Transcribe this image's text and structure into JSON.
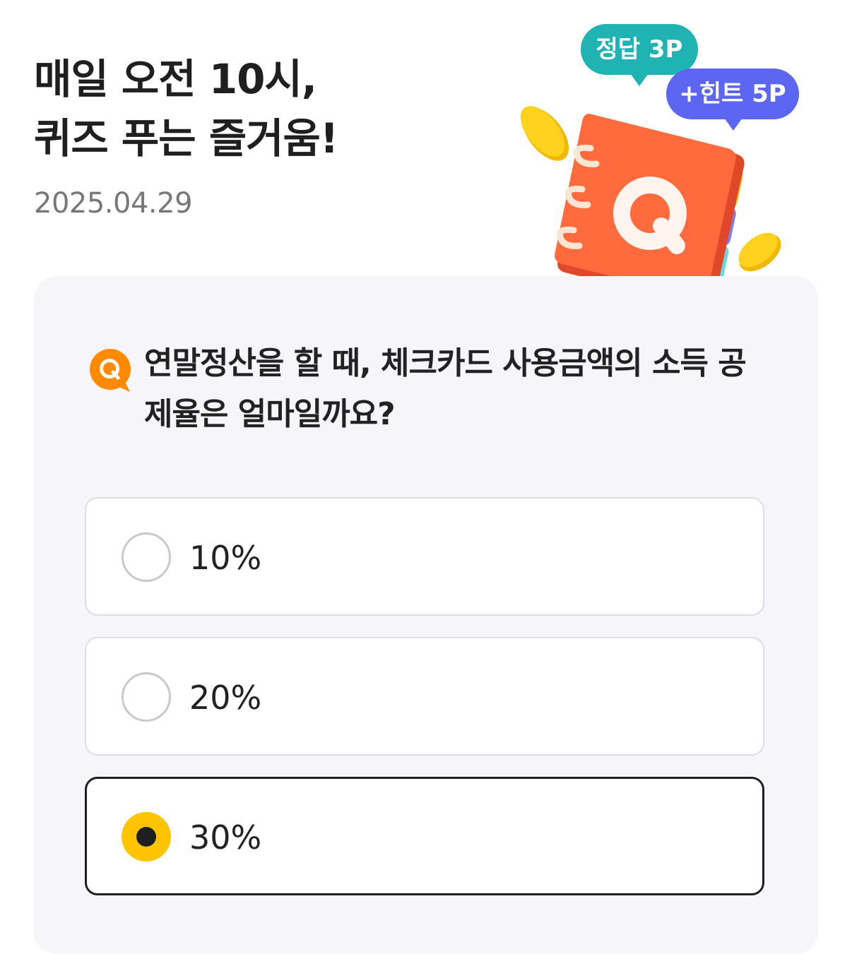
{
  "header": {
    "title_line1": "매일 오전 10시,",
    "title_line2": "퀴즈 푸는 즐거움!",
    "date": "2025.04.29"
  },
  "illustration": {
    "answer_points_label": "정답 3P",
    "hint_points_label": "+힌트 5P",
    "book_letter": "Q",
    "colors": {
      "answer_bubble": "#1fb3b3",
      "hint_bubble": "#5d66f0",
      "book": "#ff6b3d",
      "coin": "#ffd21f"
    }
  },
  "quiz": {
    "badge_letter": "Q",
    "question": "연말정산을 할 때, 체크카드 사용금액의 소득 공제율은 얼마일까요?",
    "options": [
      {
        "label": "10%",
        "selected": false
      },
      {
        "label": "20%",
        "selected": false
      },
      {
        "label": "30%",
        "selected": true
      }
    ],
    "colors": {
      "badge": "#ff8a00",
      "selected_radio": "#ffc400",
      "card_background": "#f6f6fa"
    }
  }
}
